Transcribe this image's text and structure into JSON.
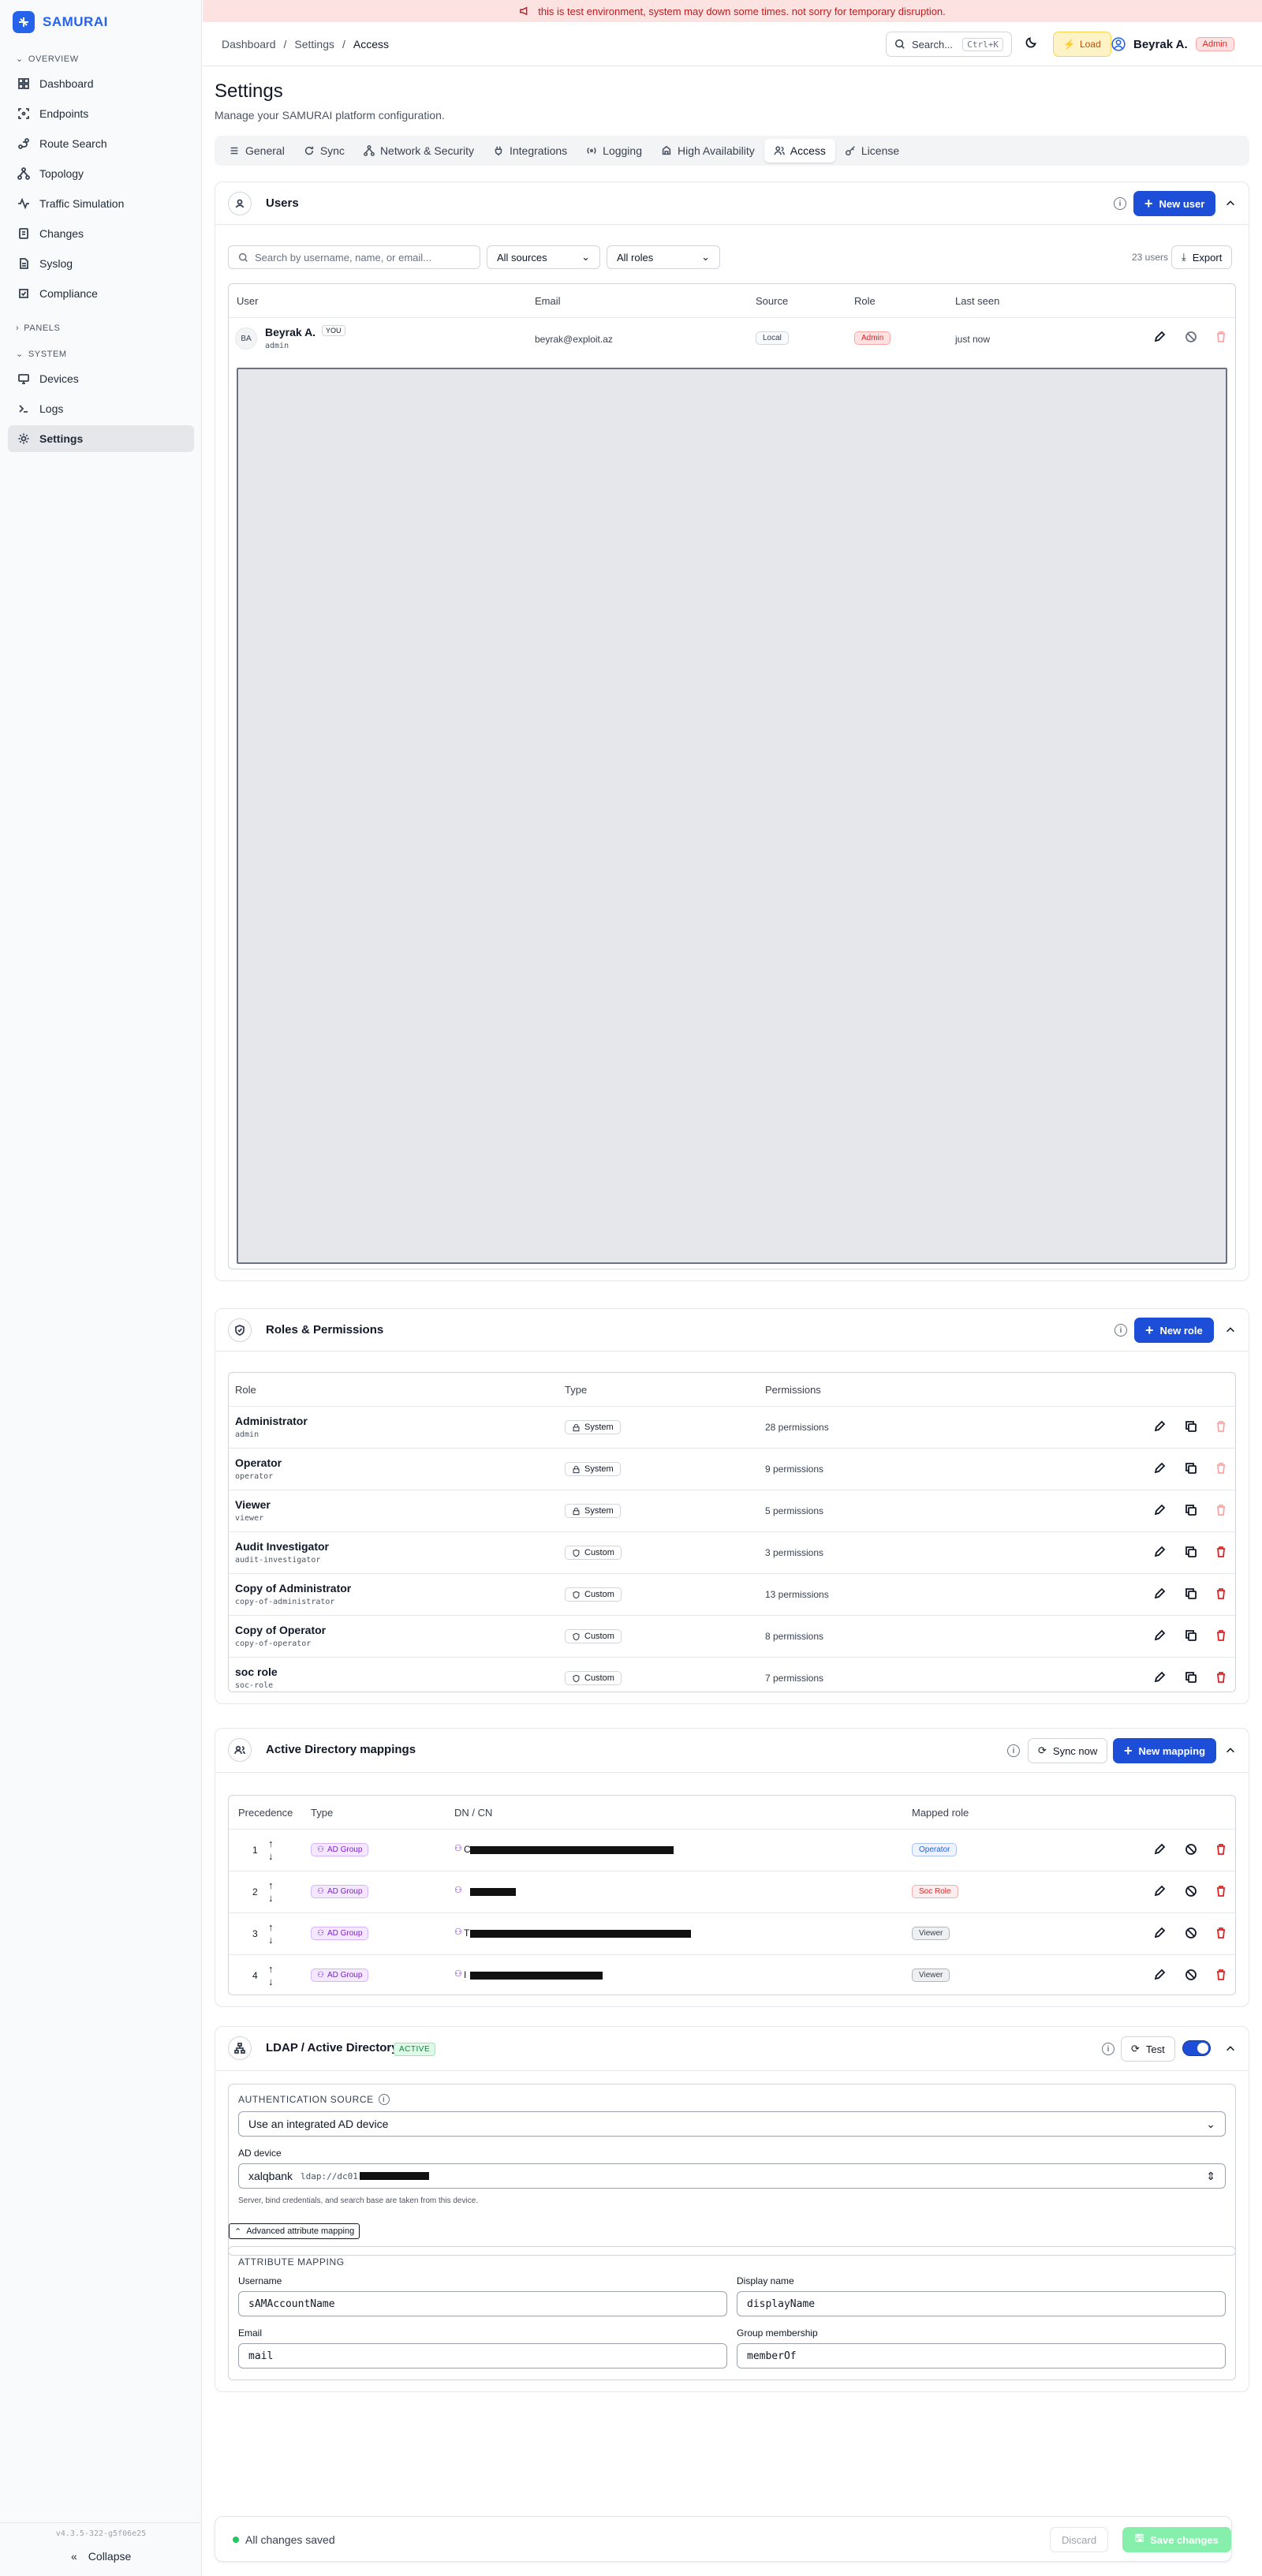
{
  "app": {
    "name": "SAMURAI",
    "version": "v4.3.5-322-g5f06e25"
  },
  "banner": {
    "text": "this is test environment, system may down some times. not sorry for temporary disruption."
  },
  "sidebar": {
    "overview_label": "OVERVIEW",
    "overview_items": [
      {
        "label": "Dashboard",
        "icon": "dashboard-icon"
      },
      {
        "label": "Endpoints",
        "icon": "endpoints-icon"
      },
      {
        "label": "Route Search",
        "icon": "route-icon"
      },
      {
        "label": "Topology",
        "icon": "topology-icon"
      },
      {
        "label": "Traffic Simulation",
        "icon": "activity-icon"
      },
      {
        "label": "Changes",
        "icon": "changes-icon"
      },
      {
        "label": "Syslog",
        "icon": "syslog-icon"
      },
      {
        "label": "Compliance",
        "icon": "compliance-icon"
      }
    ],
    "panels_label": "PANELS",
    "system_label": "SYSTEM",
    "system_items": [
      {
        "label": "Devices",
        "icon": "monitor-icon"
      },
      {
        "label": "Logs",
        "icon": "terminal-icon"
      },
      {
        "label": "Settings",
        "icon": "gear-icon"
      }
    ],
    "collapse_label": "Collapse"
  },
  "topbar": {
    "breadcrumb": [
      "Dashboard",
      "Settings",
      "Access"
    ],
    "search_label": "Search...",
    "search_shortcut": "Ctrl+K",
    "load_label": "Load",
    "user_name": "Beyrak A.",
    "user_role": "Admin"
  },
  "page": {
    "title": "Settings",
    "subtitle": "Manage your SAMURAI platform configuration."
  },
  "tabs": [
    {
      "label": "General",
      "icon": "list-icon"
    },
    {
      "label": "Sync",
      "icon": "refresh-icon"
    },
    {
      "label": "Network & Security",
      "icon": "network-icon"
    },
    {
      "label": "Integrations",
      "icon": "plug-icon"
    },
    {
      "label": "Logging",
      "icon": "broadcast-icon"
    },
    {
      "label": "High Availability",
      "icon": "cluster-icon"
    },
    {
      "label": "Access",
      "icon": "users-icon"
    },
    {
      "label": "License",
      "icon": "key-icon"
    }
  ],
  "users": {
    "title": "Users",
    "new_label": "New user",
    "search_placeholder": "Search by username, name, or email...",
    "source_filter": "All sources",
    "role_filter": "All roles",
    "count_label": "23 users",
    "export_label": "Export",
    "columns": [
      "User",
      "Email",
      "Source",
      "Role",
      "Last seen"
    ],
    "rows": [
      {
        "initials": "BA",
        "name": "Beyrak A.",
        "you": "YOU",
        "username": "admin",
        "email": "beyrak@exploit.az",
        "source": "Local",
        "role": "Admin",
        "last_seen": "just now"
      }
    ]
  },
  "roles": {
    "title": "Roles & Permissions",
    "new_label": "New role",
    "columns": [
      "Role",
      "Type",
      "Permissions"
    ],
    "rows": [
      {
        "name": "Administrator",
        "slug": "admin",
        "type": "System",
        "perms": "28 permissions",
        "deletable": false
      },
      {
        "name": "Operator",
        "slug": "operator",
        "type": "System",
        "perms": "9 permissions",
        "deletable": false
      },
      {
        "name": "Viewer",
        "slug": "viewer",
        "type": "System",
        "perms": "5 permissions",
        "deletable": false
      },
      {
        "name": "Audit Investigator",
        "slug": "audit-investigator",
        "type": "Custom",
        "perms": "3 permissions",
        "deletable": true
      },
      {
        "name": "Copy of Administrator",
        "slug": "copy-of-administrator",
        "type": "Custom",
        "perms": "13 permissions",
        "deletable": true
      },
      {
        "name": "Copy of Operator",
        "slug": "copy-of-operator",
        "type": "Custom",
        "perms": "8 permissions",
        "deletable": true
      },
      {
        "name": "soc role",
        "slug": "soc-role",
        "type": "Custom",
        "perms": "7 permissions",
        "deletable": true
      }
    ]
  },
  "ad_mappings": {
    "title": "Active Directory mappings",
    "sync_label": "Sync now",
    "new_label": "New mapping",
    "columns": [
      "Precedence",
      "Type",
      "DN / CN",
      "Mapped role"
    ],
    "rows": [
      {
        "precedence": "1",
        "type": "AD Group",
        "dn_prefix": "C",
        "role": "Operator",
        "role_color": "#2563eb"
      },
      {
        "precedence": "2",
        "type": "AD Group",
        "dn_prefix": "",
        "role": "Soc Role",
        "role_color": "#dc2626"
      },
      {
        "precedence": "3",
        "type": "AD Group",
        "dn_prefix": "T",
        "role": "Viewer",
        "role_color": "#374151"
      },
      {
        "precedence": "4",
        "type": "AD Group",
        "dn_prefix": "I",
        "role": "Viewer",
        "role_color": "#374151"
      }
    ]
  },
  "ldap": {
    "title": "LDAP / Active Directory",
    "status": "ACTIVE",
    "test_label": "Test",
    "enabled": true,
    "auth_source_label": "AUTHENTICATION SOURCE",
    "auth_source_value": "Use an integrated AD device",
    "device_label": "AD device",
    "device_name": "xalqbank",
    "device_url": "ldap://dc01",
    "device_hint": "Server, bind credentials, and search base are taken from this device.",
    "advanced_label": "Advanced attribute mapping",
    "attr_title": "ATTRIBUTE MAPPING",
    "username_label": "Username",
    "username_value": "sAMAccountName",
    "display_label": "Display name",
    "display_value": "displayName",
    "email_label": "Email",
    "email_value": "mail",
    "group_label": "Group membership",
    "group_value": "memberOf"
  },
  "footer": {
    "status": "All changes saved",
    "discard_label": "Discard",
    "save_label": "Save changes"
  }
}
